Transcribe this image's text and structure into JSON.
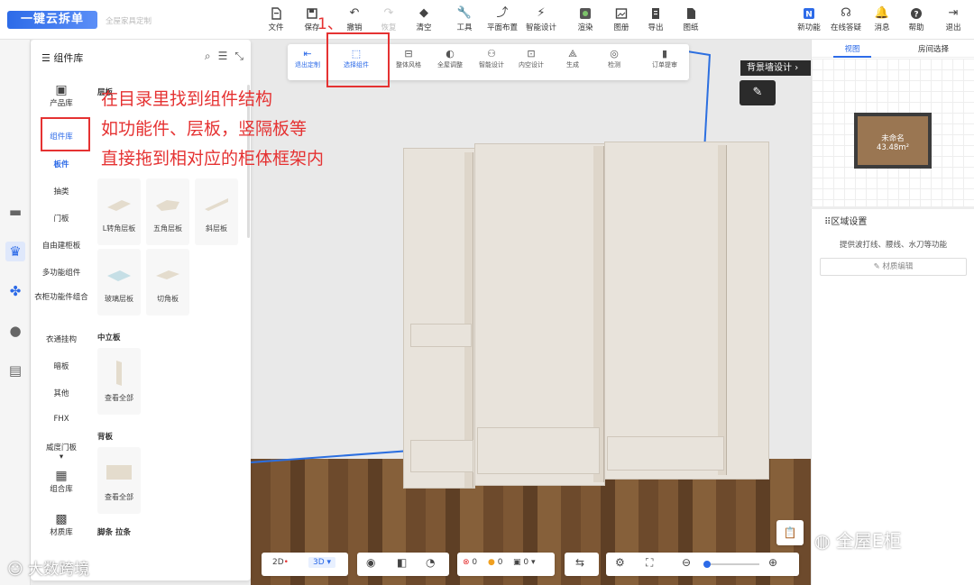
{
  "header": {
    "logo": "一键云拆单",
    "subtitle": "全屋家具定制",
    "toolbar": [
      {
        "label": "文件",
        "icon": "file-icon"
      },
      {
        "label": "保存",
        "icon": "save-icon"
      },
      {
        "label": "撤销",
        "icon": "undo-icon"
      },
      {
        "label": "恢复",
        "icon": "redo-icon",
        "disabled": true
      },
      {
        "label": "清空",
        "icon": "eraser-icon"
      },
      {
        "label": "工具",
        "icon": "wrench-icon"
      },
      {
        "label": "平面布置",
        "icon": "layout-icon"
      },
      {
        "label": "智能设计",
        "icon": "lightning-icon"
      },
      {
        "label": "渲染",
        "icon": "render-icon"
      },
      {
        "label": "图册",
        "icon": "album-icon"
      },
      {
        "label": "导出",
        "icon": "export-icon"
      },
      {
        "label": "图纸",
        "icon": "drawing-icon"
      }
    ],
    "right_toolbar": [
      {
        "label": "新功能",
        "icon": "new-feature-icon"
      },
      {
        "label": "在线答疑",
        "icon": "headset-icon"
      },
      {
        "label": "消息",
        "icon": "bell-icon"
      },
      {
        "label": "帮助",
        "icon": "help-icon"
      },
      {
        "label": "退出",
        "icon": "logout-icon"
      }
    ]
  },
  "floating_toolbar": [
    {
      "label": "退出定制",
      "icon": "exit-custom-icon"
    },
    {
      "label": "选择组件",
      "icon": "select-component-icon"
    },
    {
      "label": "整体风格",
      "icon": "style-icon"
    },
    {
      "label": "全屋调整",
      "icon": "adjust-icon"
    },
    {
      "label": "智能设计",
      "icon": "smart-design-icon"
    },
    {
      "label": "内空设计",
      "icon": "interior-icon"
    },
    {
      "label": "生成",
      "icon": "generate-icon"
    },
    {
      "label": "检测",
      "icon": "check-icon"
    },
    {
      "label": "订单提审",
      "icon": "order-icon"
    }
  ],
  "component_library": {
    "title": "组件库",
    "categories": [
      {
        "label": "产品库",
        "icon": "product-icon"
      },
      {
        "label": "组件库"
      },
      {
        "label": "板件"
      },
      {
        "label": "抽类"
      },
      {
        "label": "门板"
      },
      {
        "label": "自由建柜板"
      },
      {
        "label": "多功能组件"
      },
      {
        "label": "衣柜功能件组合"
      },
      {
        "label": "衣通挂构"
      },
      {
        "label": "暗板"
      },
      {
        "label": "其他"
      },
      {
        "label": "FHX"
      },
      {
        "label": "威度门板"
      },
      {
        "label": "组合库",
        "icon": "combo-icon"
      },
      {
        "label": "材质库",
        "icon": "material-icon"
      }
    ],
    "sections": [
      {
        "title": "层板",
        "items": [
          {
            "label": "L转角层板"
          },
          {
            "label": "五角层板"
          },
          {
            "label": "斜层板"
          },
          {
            "label": "玻璃层板"
          },
          {
            "label": "切角板"
          }
        ]
      },
      {
        "title": "中立板",
        "items": [
          {
            "label": "查看全部"
          }
        ]
      },
      {
        "title": "背板",
        "items": [
          {
            "label": "查看全部"
          }
        ]
      },
      {
        "title": "脚条 拉条",
        "items": []
      }
    ]
  },
  "annotations": {
    "step": "1、",
    "lines": [
      "在目录里找到组件结构",
      "如功能件、层板，竖隔板等",
      "直接拖到相对应的柜体框架内"
    ]
  },
  "viewport": {
    "bg_wall_button": "背景墙设计",
    "bg_wall_arrow": "›"
  },
  "right_panel": {
    "tabs": [
      "视图",
      "房间选择"
    ],
    "room_name": "未命名",
    "room_area": "43.48m²",
    "region_title": "区域设置",
    "region_desc": "提供波打线、腰线、水刀等功能",
    "material_edit": "材质编辑"
  },
  "bottom_toolbar": {
    "mode_2d": "2D",
    "mode_3d": "3D",
    "err_count": "0",
    "warn_count": "0",
    "info_count": "0"
  },
  "watermark": {
    "right": "全屋E柜",
    "left": "大数跨境"
  },
  "colors": {
    "accent": "#2d6be8",
    "annotation": "#e53232"
  }
}
